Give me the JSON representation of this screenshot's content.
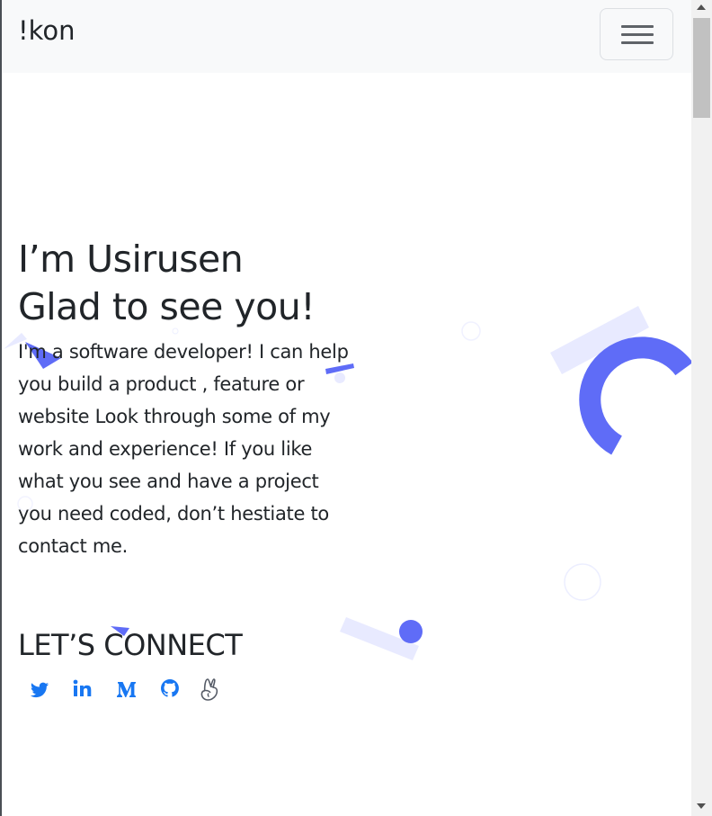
{
  "navbar": {
    "brand": "!kon",
    "toggle_icon": "hamburger-menu-icon"
  },
  "hero": {
    "headline_line1": "I’m Usirusen",
    "headline_line2": "Glad to see you!",
    "intro": "I'm a software developer! I can help you build a product , feature or website Look through some of my work and experience! If you like what you see and have a project you need coded, don’t hestiate to contact me."
  },
  "connect": {
    "heading": "LET’S CONNECT",
    "links": [
      {
        "icon": "twitter-icon"
      },
      {
        "icon": "linkedin-icon"
      },
      {
        "icon": "medium-icon"
      },
      {
        "icon": "github-icon"
      },
      {
        "icon": "angellist-icon"
      }
    ]
  },
  "colors": {
    "accent": "#5f6cf7",
    "accent_light": "#e8eaff",
    "link": "#1877f2",
    "navbar_bg": "#f8f9fa",
    "text": "#212529"
  }
}
